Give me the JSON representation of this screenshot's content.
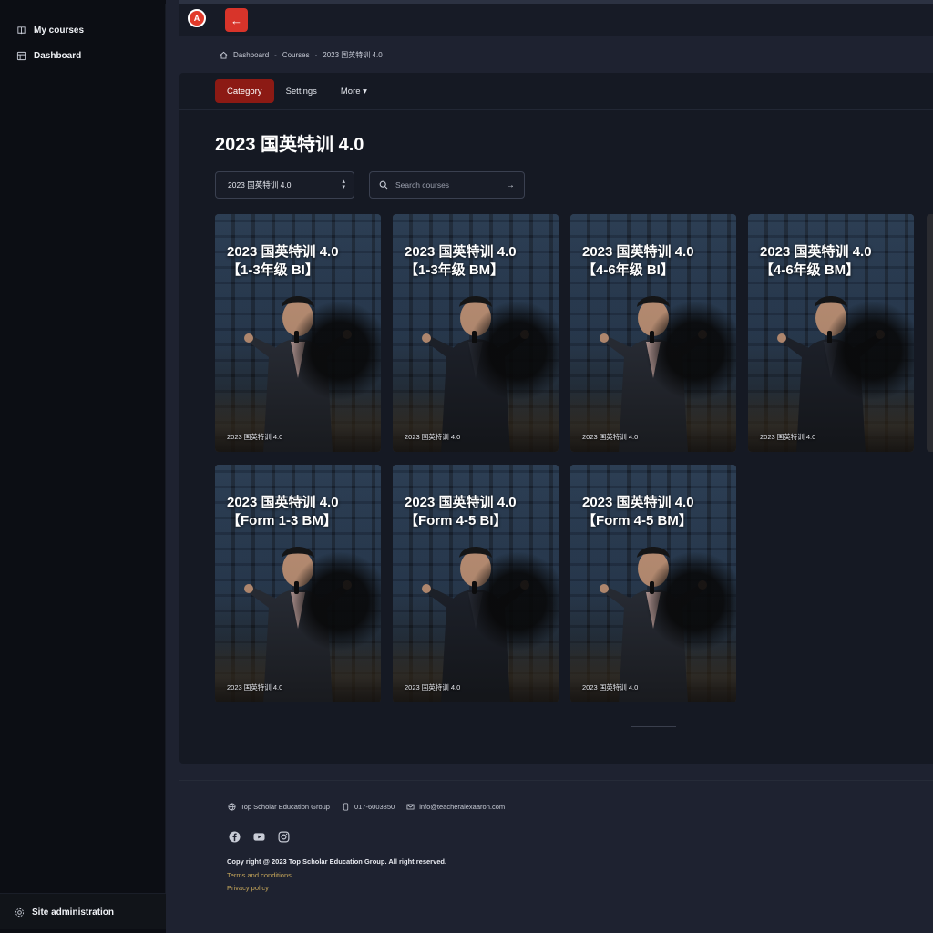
{
  "sidebar": {
    "items": [
      {
        "label": "My courses",
        "icon": "book-icon"
      },
      {
        "label": "Dashboard",
        "icon": "dashboard-icon"
      }
    ],
    "bottom": {
      "label": "Site administration",
      "icon": "gear-icon"
    }
  },
  "topbar": {
    "logo_text": "A",
    "back_label": "←"
  },
  "breadcrumb": [
    "Dashboard",
    "Courses",
    "2023 国英特训 4.0"
  ],
  "tabs": [
    {
      "label": "Category",
      "active": true
    },
    {
      "label": "Settings",
      "active": false
    },
    {
      "label": "More ▾",
      "active": false
    }
  ],
  "page_title": "2023 国英特训 4.0",
  "category_select": {
    "value": "2023 国英特训 4.0"
  },
  "search": {
    "placeholder": "Search courses"
  },
  "courses": [
    {
      "title_line1": "2023 国英特训 4.0",
      "title_line2": "【1-3年级 BI】",
      "category": "2023 国英特训 4.0"
    },
    {
      "title_line1": "2023 国英特训 4.0",
      "title_line2": "【1-3年级 BM】",
      "category": "2023 国英特训 4.0"
    },
    {
      "title_line1": "2023 国英特训 4.0",
      "title_line2": "【4-6年级 BI】",
      "category": "2023 国英特训 4.0"
    },
    {
      "title_line1": "2023 国英特训 4.0",
      "title_line2": "【4-6年级 BM】",
      "category": "2023 国英特训 4.0"
    },
    {
      "title_line1": "2023 国英特训 4.0",
      "title_line2": "【Form 1-3 BM】",
      "category": "2023 国英特训 4.0"
    },
    {
      "title_line1": "2023 国英特训 4.0",
      "title_line2": "【Form 4-5 BI】",
      "category": "2023 国英特训 4.0"
    },
    {
      "title_line1": "2023 国英特训 4.0",
      "title_line2": "【Form 4-5 BM】",
      "category": "2023 国英特训 4.0"
    }
  ],
  "footer": {
    "org": "Top Scholar Education Group",
    "phone": "017-6003850",
    "email": "info@teacheralexaaron.com",
    "socials": [
      "facebook-icon",
      "youtube-icon",
      "instagram-icon"
    ],
    "copyright": "Copy right @ 2023 Top Scholar Education Group. All right reserved.",
    "terms": "Terms and conditions",
    "privacy": "Privacy policy"
  },
  "colors": {
    "accent": "#d8342a",
    "active_tab": "#8c1a14",
    "link": "#c4a55a"
  }
}
